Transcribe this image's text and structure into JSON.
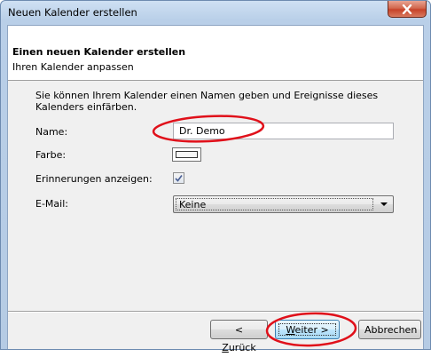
{
  "window": {
    "title": "Neuen Kalender erstellen",
    "close_icon": "close-icon"
  },
  "header": {
    "title": "Einen neuen Kalender erstellen",
    "subtitle": "Ihren Kalender anpassen"
  },
  "form": {
    "intro": "Sie können Ihrem Kalender einen Namen geben und Ereignisse dieses Kalenders einfärben.",
    "name_label": "Name:",
    "name_value": "Dr. Demo",
    "color_label": "Farbe:",
    "reminders_label": "Erinnerungen anzeigen:",
    "reminders_checked": true,
    "email_label": "E-Mail:",
    "email_value": "Keine"
  },
  "buttons": {
    "back_prefix": "< ",
    "back_key": "Z",
    "back_rest": "urück",
    "next_key": "W",
    "next_rest": "eiter >",
    "cancel": "Abbrechen"
  },
  "colors": {
    "annotation": "#e0101a",
    "check": "#4a5f94"
  }
}
